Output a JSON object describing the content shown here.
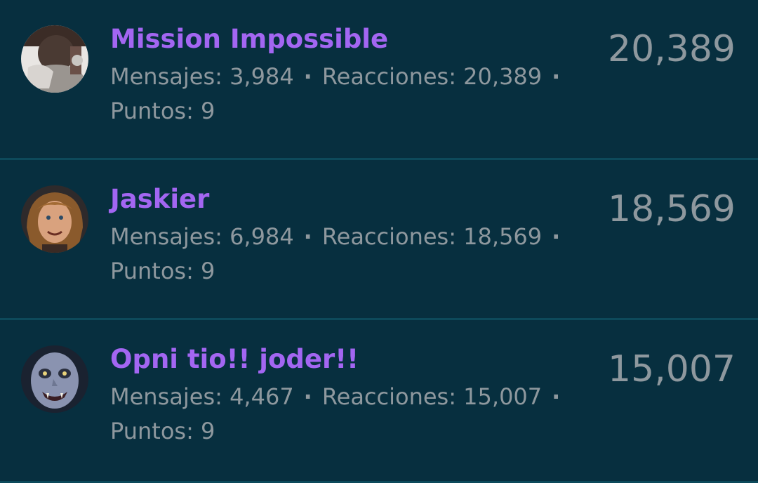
{
  "separator": "·",
  "users": [
    {
      "name": "Mission Impossible",
      "avatar_icon": "mission-impossible-avatar",
      "messages_label": "Mensajes:",
      "messages": "3,984",
      "reactions_label": "Reacciones:",
      "reactions": "20,389",
      "points_label": "Puntos:",
      "points": "9",
      "score": "20,389"
    },
    {
      "name": "Jaskier",
      "avatar_icon": "jaskier-avatar",
      "messages_label": "Mensajes:",
      "messages": "6,984",
      "reactions_label": "Reacciones:",
      "reactions": "18,569",
      "points_label": "Puntos:",
      "points": "9",
      "score": "18,569"
    },
    {
      "name": "Opni tio!! joder!!",
      "avatar_icon": "ghoul-avatar",
      "messages_label": "Mensajes:",
      "messages": "4,467",
      "reactions_label": "Reacciones:",
      "reactions": "15,007",
      "points_label": "Puntos:",
      "points": "9",
      "score": "15,007"
    }
  ],
  "colors": {
    "background": "#072f3f",
    "divider": "#0d4a5b",
    "username": "#a366f2",
    "muted_text": "#8e989e"
  }
}
